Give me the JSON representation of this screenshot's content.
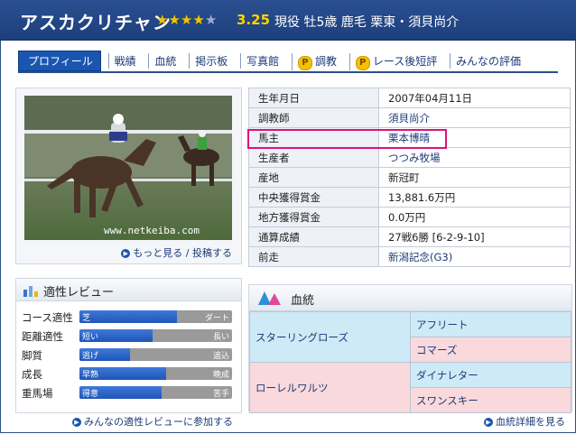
{
  "header": {
    "horse_name": "アスカクリチャン",
    "stars": [
      "★",
      "★",
      "★",
      "★",
      "★"
    ],
    "rating": "3.25",
    "info": "現役 牡5歳 鹿毛 栗東・須貝尚介"
  },
  "nav": {
    "active": "プロフィール",
    "items": [
      "戦績",
      "血統",
      "掲示板",
      "写真館",
      "調教",
      "レース後短評",
      "みんなの評価"
    ],
    "p_icon": "P"
  },
  "photo": {
    "watermark": "www.netkeiba.com",
    "more_label": "もっと見る",
    "sep": "/",
    "post_label": "投稿する"
  },
  "profile": [
    {
      "key": "生年月日",
      "value": "2007年04月11日"
    },
    {
      "key": "調教師",
      "value": "須貝尚介"
    },
    {
      "key": "馬主",
      "value": "栗本博晴"
    },
    {
      "key": "生産者",
      "value": "つつみ牧場"
    },
    {
      "key": "産地",
      "value": "新冠町"
    },
    {
      "key": "中央獲得賞金",
      "value": "13,881.6万円"
    },
    {
      "key": "地方獲得賞金",
      "value": "0.0万円"
    },
    {
      "key": "通算成績",
      "value": "27戦6勝 [6-2-9-10]"
    },
    {
      "key": "前走",
      "value": "新潟記念(G3)"
    }
  ],
  "aptitude": {
    "title": "適性レビュー",
    "rows": [
      {
        "label": "コース適性",
        "left": "芝",
        "right": "ダート",
        "level": 0.64
      },
      {
        "label": "距離適性",
        "left": "短い",
        "right": "長い",
        "level": 0.48
      },
      {
        "label": "脚質",
        "left": "逃げ",
        "right": "追込",
        "level": 0.33
      },
      {
        "label": "成長",
        "left": "早熟",
        "right": "晩成",
        "level": 0.57
      },
      {
        "label": "重馬場",
        "left": "得意",
        "right": "苦手",
        "level": 0.54
      }
    ],
    "link": "みんなの適性レビューに参加する"
  },
  "pedigree": {
    "title": "血統",
    "sire": "スターリングローズ",
    "sire_sire": "アフリート",
    "sire_dam": "コマーズ",
    "dam": "ローレルワルツ",
    "dam_sire": "ダイナレター",
    "dam_dam": "スワンスキー",
    "link": "血統詳細を見る"
  },
  "colors": {
    "header_bg": "#23478a",
    "accent": "#1a56b0",
    "highlight": "#e0107a",
    "sire_bg": "#cdeaf6",
    "dam_bg": "#f9d9dc"
  }
}
